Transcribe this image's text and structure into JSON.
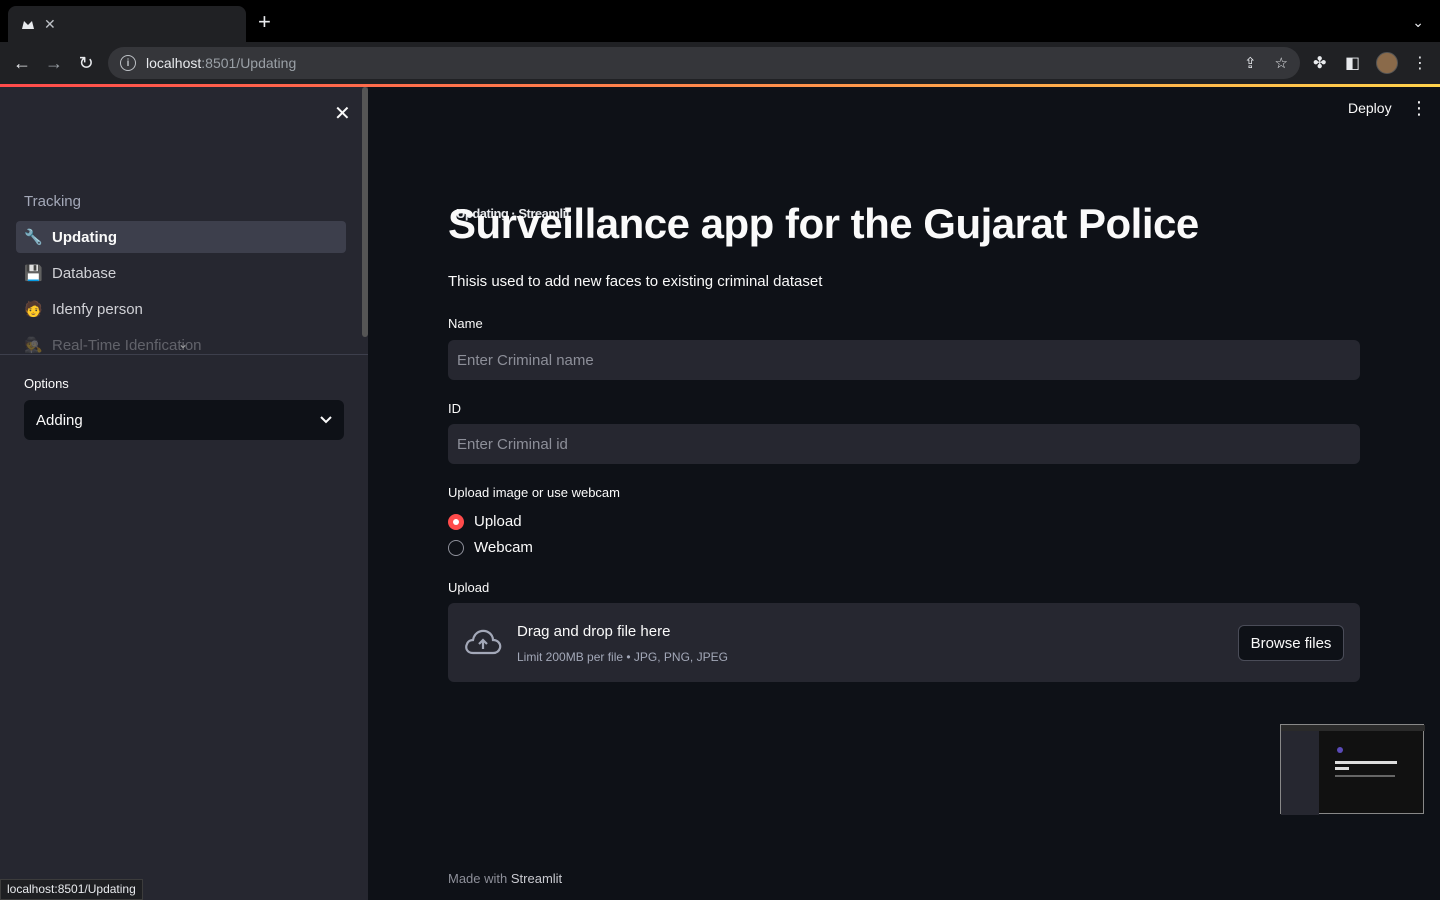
{
  "browser": {
    "tab_title": "Updating · Streamlit",
    "url_host": "localhost",
    "url_rest": ":8501/Updating",
    "status_url": "localhost:8501/Updating"
  },
  "sidebar": {
    "section_label": "Tracking",
    "items": [
      {
        "label": "Updating",
        "icon": "wrench-icon",
        "emoji": "🔧",
        "active": true
      },
      {
        "label": "Database",
        "icon": "floppy-disk-icon",
        "emoji": "💾"
      },
      {
        "label": "Idenfy person",
        "icon": "face-icon",
        "emoji": "🧑"
      },
      {
        "label": "Real-Time Idenfication",
        "icon": "detective-icon",
        "emoji": "🕵️"
      }
    ],
    "options_label": "Options",
    "options_selected": "Adding"
  },
  "header": {
    "deploy_label": "Deploy"
  },
  "main": {
    "title": "Surveillance app for the Gujarat Police",
    "subtitle": "Thisis used to add new faces to existing criminal dataset",
    "name_label": "Name",
    "name_placeholder": "Enter Criminal name",
    "id_label": "ID",
    "id_placeholder": "Enter Criminal id",
    "radio_label": "Upload image or use webcam",
    "radio_options": [
      "Upload",
      "Webcam"
    ],
    "radio_selected": "Upload",
    "upload_label": "Upload",
    "dropzone_title": "Drag and drop file here",
    "dropzone_sub": "Limit 200MB per file • JPG, PNG, JPEG",
    "browse_label": "Browse files"
  },
  "footer": {
    "prefix": "Made with",
    "brand": "Streamlit"
  },
  "colors": {
    "accent": "#ff4b4b",
    "background": "#0e1117",
    "sidebar": "#262730"
  }
}
